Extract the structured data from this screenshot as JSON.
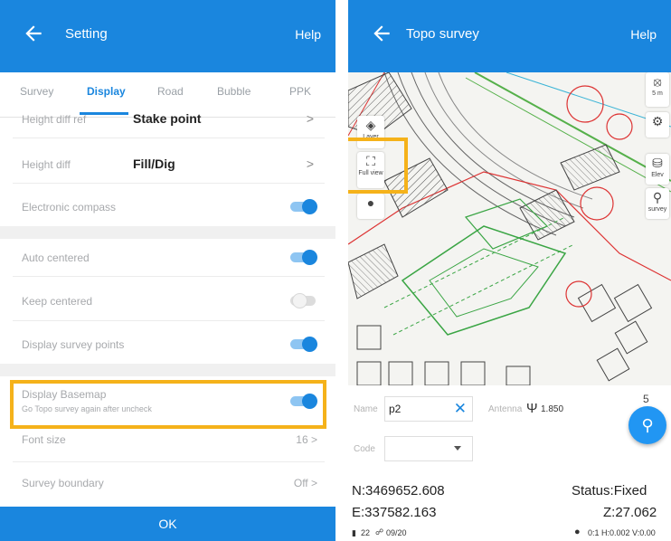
{
  "settings": {
    "title": "Setting",
    "help": "Help",
    "tabs": [
      "Survey",
      "Display",
      "Road",
      "Bubble",
      "PPK"
    ],
    "active_tab": "Display",
    "height_diff_ref_label": "Height diff ref",
    "height_diff_ref_value": "Stake point",
    "height_diff_label": "Height diff",
    "height_diff_value": "Fill/Dig",
    "electronic_compass": "Electronic compass",
    "auto_centered": "Auto centered",
    "keep_centered": "Keep centered",
    "display_survey_points": "Display survey points",
    "display_basemap": "Display Basemap",
    "display_basemap_hint": "Go Topo survey again after uncheck",
    "font_size_label": "Font size",
    "font_size_value": "16",
    "survey_boundary_label": "Survey boundary",
    "survey_boundary_value": "Off",
    "ok": "OK",
    "toggles": {
      "electronic_compass": true,
      "auto_centered": true,
      "keep_centered": false,
      "display_survey_points": true,
      "display_basemap": true
    },
    "accent_color": "#1a86de",
    "highlight_color": "#f5b21a"
  },
  "survey": {
    "title": "Topo survey",
    "help": "Help",
    "map_labels": {
      "layer_tool": "Layer",
      "full_view_tool": "Full view",
      "elev_tool": "Elev",
      "survey_tool": "survey",
      "scale": "5 m"
    },
    "name_label": "Name",
    "name_value": "p2",
    "antenna_label": "Antenna",
    "antenna_value": "1.850",
    "code_label": "Code",
    "count": "5",
    "northing": "N:3469652.608",
    "easting": "E:337582.163",
    "status": "Status:Fixed",
    "z": "Z:27.062",
    "sats": "22",
    "age": "09/20",
    "precision": "0:1 H:0.002 V:0.00"
  }
}
